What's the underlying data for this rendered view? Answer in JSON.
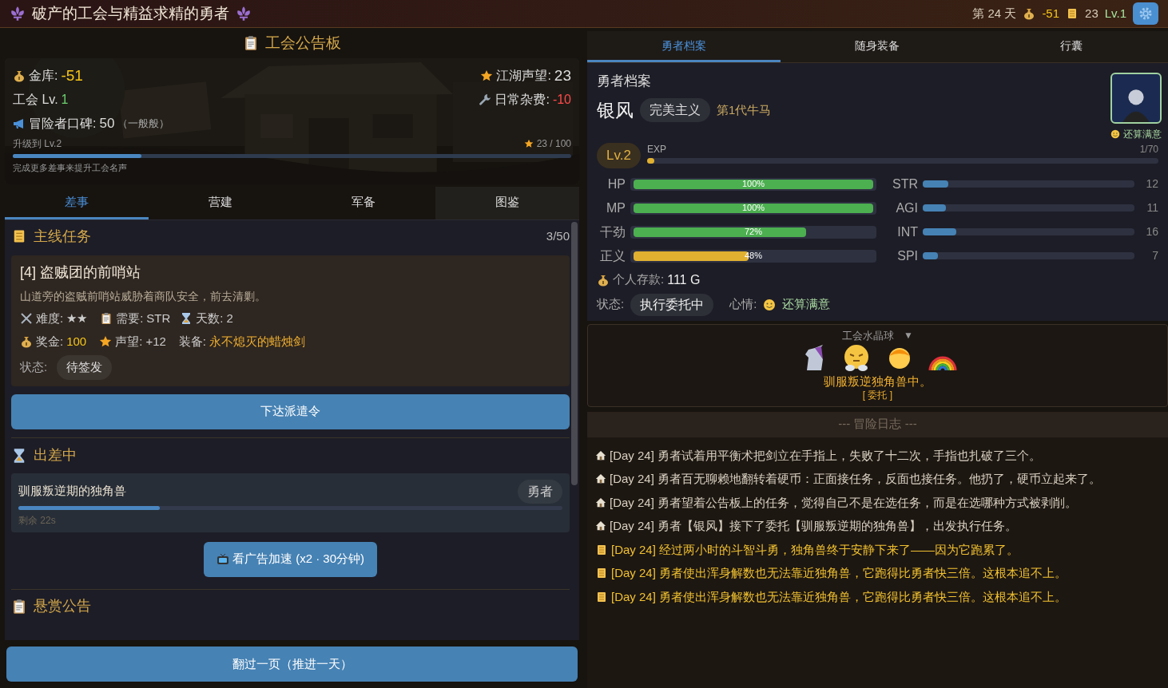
{
  "header": {
    "title": "破产的工会与精益求精的勇者",
    "day": "第 24 天",
    "gold": "-51",
    "scrolls": "23",
    "level": "Lv.1"
  },
  "guild_board": {
    "title": "工会公告板",
    "treasury_label": "金库:",
    "treasury": "-51",
    "guild_level_label": "工会 Lv.",
    "guild_level": "1",
    "reputation_label": "冒险者口碑:",
    "reputation": "50",
    "reputation_note": "（一般般）",
    "fame_label": "江湖声望:",
    "fame": "23",
    "upkeep_label": "日常杂费:",
    "upkeep": "-10",
    "upgrade_label": "升级到 Lv.2",
    "upgrade_progress": "23 / 100",
    "level": 0.23,
    "hint": "完成更多差事来提升工会名声"
  },
  "left_tabs": [
    {
      "label": "差事",
      "selected": true
    },
    {
      "label": "营建",
      "selected": false
    },
    {
      "label": "军备",
      "selected": false
    },
    {
      "label": "图鉴",
      "selected": false
    }
  ],
  "main_quest": {
    "title": "主线任务",
    "count": "3/50",
    "quest": {
      "name": "[4] 盗贼团的前哨站",
      "description": "山道旁的盗贼前哨站威胁着商队安全，前去清剿。",
      "difficulty_label": "难度:",
      "difficulty": "★★",
      "need_label": "需要:",
      "need": "STR",
      "days_label": "天数:",
      "days": "2",
      "reward_label": "奖金:",
      "reward": "100",
      "fame_label": "声望:",
      "fame": "+12",
      "gear_label": "装备:",
      "gear": "永不熄灭的蜡烛剑",
      "status_label": "状态:",
      "status": "待签发"
    },
    "button": "下达派遣令"
  },
  "on_mission": {
    "title": "出差中",
    "mission": {
      "name": "驯服叛逆期的独角兽",
      "assignee": "勇者",
      "level": 0.26,
      "remaining": "剩余 22s"
    },
    "ad_button": "看广告加速 (x2 · 30分钟)"
  },
  "bounty": {
    "title": "悬赏公告"
  },
  "next_day_button": "翻过一页（推进一天）",
  "right_tabs": [
    {
      "label": "勇者档案",
      "selected": true
    },
    {
      "label": "随身装备",
      "selected": false
    },
    {
      "label": "行囊",
      "selected": false
    }
  ],
  "hero": {
    "section_title": "勇者档案",
    "name": "银风",
    "trait": "完美主义",
    "generation": "第1代牛马",
    "mood_badge": "还算满意",
    "level_badge": "Lv.2",
    "exp": {
      "label": "EXP",
      "value": "1/70",
      "level": 0.014
    },
    "vitals": [
      {
        "label": "HP",
        "reading": "100%",
        "level": 1,
        "color": "#4caf50"
      },
      {
        "label": "MP",
        "reading": "100%",
        "level": 1,
        "color": "#4caf50"
      },
      {
        "label": "干劲",
        "reading": "72%",
        "level": 0.72,
        "color": "#4caf50"
      },
      {
        "label": "正义",
        "reading": "48%",
        "level": 0.48,
        "color": "#e0b030"
      }
    ],
    "attributes": [
      {
        "label": "STR",
        "value": "12",
        "level": 0.12
      },
      {
        "label": "AGI",
        "value": "11",
        "level": 0.11
      },
      {
        "label": "INT",
        "value": "16",
        "level": 0.16
      },
      {
        "label": "SPI",
        "value": "7",
        "level": 0.07
      }
    ],
    "savings_label": "个人存款:",
    "savings": "111 G",
    "status_label": "状态:",
    "status": "执行委托中",
    "mood_label": "心情:",
    "mood": "还算满意"
  },
  "crystal_ball": {
    "title": "工会水晶球",
    "toggle": "▼",
    "message": "驯服叛逆独角兽中。",
    "tag": "[ 委托 ]"
  },
  "log": {
    "title": "--- 冒险日志 ---",
    "entries": [
      {
        "kind": "event",
        "text": "[Day 24] 勇者试着用平衡术把剑立在手指上，失败了十二次，手指也扎破了三个。"
      },
      {
        "kind": "event",
        "text": "[Day 24] 勇者百无聊赖地翻转着硬币：正面接任务，反面也接任务。他扔了，硬币立起来了。"
      },
      {
        "kind": "event",
        "text": "[Day 24] 勇者望着公告板上的任务，觉得自己不是在选任务，而是在选哪种方式被剥削。"
      },
      {
        "kind": "event",
        "text": "[Day 24] 勇者【银风】接下了委托【驯服叛逆期的独角兽】，出发执行任务。"
      },
      {
        "kind": "quest",
        "text": "[Day 24] 经过两小时的斗智斗勇，独角兽终于安静下来了——因为它跑累了。"
      },
      {
        "kind": "quest",
        "text": "[Day 24] 勇者使出浑身解数也无法靠近独角兽，它跑得比勇者快三倍。这根本追不上。"
      },
      {
        "kind": "quest",
        "text": "[Day 24] 勇者使出浑身解数也无法靠近独角兽，它跑得比勇者快三倍。这根本追不上。"
      }
    ]
  }
}
